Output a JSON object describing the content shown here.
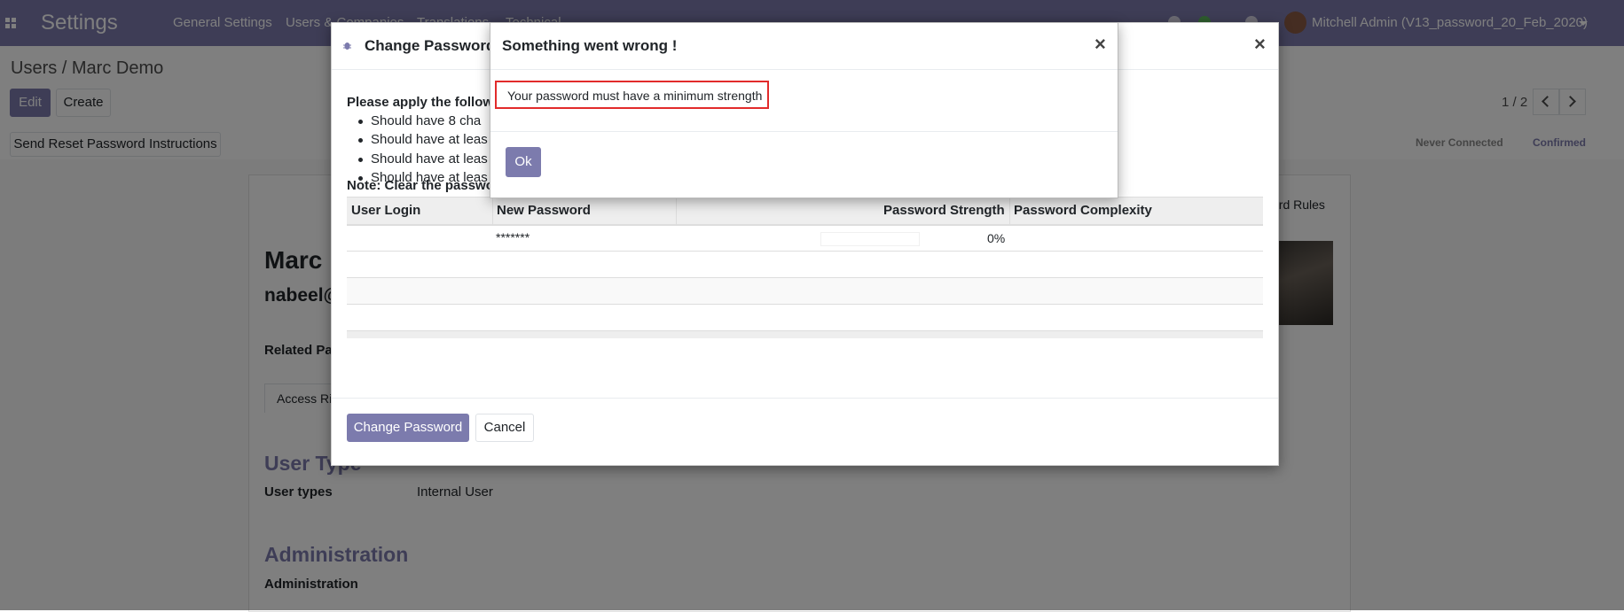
{
  "topbar": {
    "app_title": "Settings",
    "menus": [
      "General Settings",
      "Users & Companies",
      "Translations",
      "Technical"
    ],
    "user": "Mitchell Admin (V13_password_20_Feb_2020)",
    "colors": {
      "brand": "#7c7bad"
    },
    "icons": [
      "apps-icon",
      "bug-icon",
      "chat-icon",
      "activity-icon",
      "user-avatar"
    ]
  },
  "control": {
    "breadcrumb": "Users / Marc Demo",
    "edit_label": "Edit",
    "create_label": "Create",
    "pager": "1 / 2"
  },
  "statusbar": {
    "action": "Send Reset Password Instructions",
    "steps": [
      "Never Connected",
      "Confirmed"
    ]
  },
  "form": {
    "name": "Marc",
    "login": "nabeel@",
    "related_partner": "Related Pa",
    "tab_access_rights": "Access Ri",
    "tab_record_rules": "cord Rules",
    "section_user_type": "User Type",
    "user_types_label": "User types",
    "user_types_value": "Internal User",
    "section_administration": "Administration",
    "administration_label": "Administration"
  },
  "change_password": {
    "title": "Change Password",
    "intro": "Please apply the followin",
    "rules": [
      "Should have 8 cha",
      "Should have at leas",
      "Should have at leas",
      "Should have at leas"
    ],
    "note": "Note: Clear the password field to enter a new password",
    "columns": [
      "User Login",
      "New Password",
      "Password Strength",
      "Password Complexity"
    ],
    "row": {
      "login": "",
      "password": "*******",
      "strength": "0%"
    },
    "strength_fill": 0,
    "submit_label": "Change Password",
    "cancel_label": "Cancel"
  },
  "error_dialog": {
    "title": "Something went wrong !",
    "message": "Your password must have a minimum strength",
    "ok_label": "Ok"
  }
}
